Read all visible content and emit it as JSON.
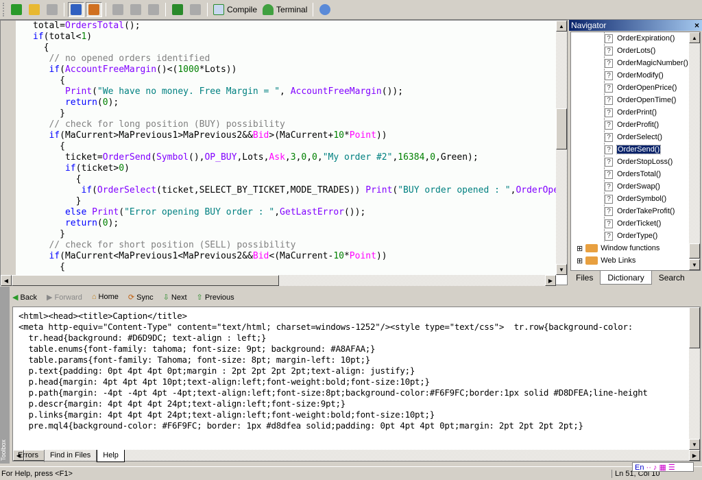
{
  "toolbar": {
    "items": [
      {
        "name": "new-file",
        "icon": "new-document-icon",
        "color": "#2a9a2a"
      },
      {
        "name": "open",
        "icon": "folder-open-icon",
        "color": "#e8b830"
      },
      {
        "name": "save",
        "icon": "save-disk-icon",
        "color": "#aaaaaa"
      },
      {
        "name": "navigator",
        "icon": "navigator-panel-icon",
        "color": "#3060c0",
        "pressed": true
      },
      {
        "name": "toolbox",
        "icon": "toolbox-book-icon",
        "color": "#d07020",
        "pressed": true
      },
      {
        "name": "cut",
        "icon": "scissors-icon",
        "color": "#aaaaaa"
      },
      {
        "name": "copy",
        "icon": "copy-icon",
        "color": "#aaaaaa"
      },
      {
        "name": "paste",
        "icon": "paste-icon",
        "color": "#aaaaaa"
      },
      {
        "name": "undo",
        "icon": "undo-arrow-icon",
        "color": "#2a8a2a"
      },
      {
        "name": "redo",
        "icon": "redo-arrow-icon",
        "color": "#aaaaaa"
      }
    ],
    "compile_label": "Compile",
    "terminal_label": "Terminal"
  },
  "editor": {
    "lines": [
      [
        [
          "t",
          "total="
        ],
        [
          "f",
          "OrdersTotal"
        ],
        [
          "t",
          "();"
        ]
      ],
      [
        [
          "k",
          "if"
        ],
        [
          "t",
          "(total<"
        ],
        [
          "n",
          "1"
        ],
        [
          "t",
          ")"
        ]
      ],
      [
        [
          "t",
          "  {"
        ]
      ],
      [
        [
          "c",
          "   // no opened orders identified"
        ]
      ],
      [
        [
          "k",
          "   if"
        ],
        [
          "t",
          "("
        ],
        [
          "f",
          "AccountFreeMargin"
        ],
        [
          "t",
          "()<("
        ],
        [
          "n",
          "1000"
        ],
        [
          "t",
          "*Lots))"
        ]
      ],
      [
        [
          "t",
          "     {"
        ]
      ],
      [
        [
          "f",
          "      Print"
        ],
        [
          "t",
          "("
        ],
        [
          "s",
          "\"We have no money. Free Margin = \""
        ],
        [
          "t",
          ", "
        ],
        [
          "f",
          "AccountFreeMargin"
        ],
        [
          "t",
          "());"
        ]
      ],
      [
        [
          "k",
          "      return"
        ],
        [
          "t",
          "("
        ],
        [
          "n",
          "0"
        ],
        [
          "t",
          ");"
        ]
      ],
      [
        [
          "t",
          "     }"
        ]
      ],
      [
        [
          "c",
          "   // check for long position (BUY) possibility"
        ]
      ],
      [
        [
          "k",
          "   if"
        ],
        [
          "t",
          "(MaCurrent>MaPrevious1>MaPrevious2&&"
        ],
        [
          "p",
          "Bid"
        ],
        [
          "t",
          ">(MaCurrent+"
        ],
        [
          "n",
          "10"
        ],
        [
          "t",
          "*"
        ],
        [
          "p",
          "Point"
        ],
        [
          "t",
          "))"
        ]
      ],
      [
        [
          "t",
          "     {"
        ]
      ],
      [
        [
          "t",
          "      ticket="
        ],
        [
          "f",
          "OrderSend"
        ],
        [
          "t",
          "("
        ],
        [
          "f",
          "Symbol"
        ],
        [
          "t",
          "(),"
        ],
        [
          "f",
          "OP_BUY"
        ],
        [
          "t",
          ",Lots,"
        ],
        [
          "p",
          "Ask"
        ],
        [
          "t",
          ","
        ],
        [
          "n",
          "3"
        ],
        [
          "t",
          ","
        ],
        [
          "n",
          "0"
        ],
        [
          "t",
          ","
        ],
        [
          "n",
          "0"
        ],
        [
          "t",
          ","
        ],
        [
          "s",
          "\"My order #2\""
        ],
        [
          "t",
          ","
        ],
        [
          "n",
          "16384"
        ],
        [
          "t",
          ","
        ],
        [
          "n",
          "0"
        ],
        [
          "t",
          ",Green);"
        ]
      ],
      [
        [
          "k",
          "      if"
        ],
        [
          "t",
          "(ticket>"
        ],
        [
          "n",
          "0"
        ],
        [
          "t",
          ")"
        ]
      ],
      [
        [
          "t",
          "        {"
        ]
      ],
      [
        [
          "k",
          "         if"
        ],
        [
          "t",
          "("
        ],
        [
          "f",
          "OrderSelect"
        ],
        [
          "t",
          "(ticket,SELECT_BY_TICKET,MODE_TRADES)) "
        ],
        [
          "f",
          "Print"
        ],
        [
          "t",
          "("
        ],
        [
          "s",
          "\"BUY order opened : \""
        ],
        [
          "t",
          ","
        ],
        [
          "f",
          "OrderOpenPrice"
        ],
        [
          "t",
          "());"
        ]
      ],
      [
        [
          "t",
          "        }"
        ]
      ],
      [
        [
          "k",
          "      else "
        ],
        [
          "f",
          "Print"
        ],
        [
          "t",
          "("
        ],
        [
          "s",
          "\"Error opening BUY order : \""
        ],
        [
          "t",
          ","
        ],
        [
          "f",
          "GetLastError"
        ],
        [
          "t",
          "());"
        ]
      ],
      [
        [
          "k",
          "      return"
        ],
        [
          "t",
          "("
        ],
        [
          "n",
          "0"
        ],
        [
          "t",
          ");"
        ]
      ],
      [
        [
          "t",
          "     }"
        ]
      ],
      [
        [
          "c",
          "   // check for short position (SELL) possibility"
        ]
      ],
      [
        [
          "k",
          "   if"
        ],
        [
          "t",
          "(MaCurrent<MaPrevious1<MaPrevious2&&"
        ],
        [
          "p",
          "Bid"
        ],
        [
          "t",
          "<(MaCurrent-"
        ],
        [
          "n",
          "10"
        ],
        [
          "t",
          "*"
        ],
        [
          "p",
          "Point"
        ],
        [
          "t",
          "))"
        ]
      ],
      [
        [
          "t",
          "     {"
        ]
      ]
    ]
  },
  "navigator": {
    "title": "Navigator",
    "items": [
      "OrderExpiration()",
      "OrderLots()",
      "OrderMagicNumber()",
      "OrderModify()",
      "OrderOpenPrice()",
      "OrderOpenTime()",
      "OrderPrint()",
      "OrderProfit()",
      "OrderSelect()",
      "OrderSend()",
      "OrderStopLoss()",
      "OrdersTotal()",
      "OrderSwap()",
      "OrderSymbol()",
      "OrderTakeProfit()",
      "OrderTicket()",
      "OrderType()"
    ],
    "selected": "OrderSend()",
    "folders": [
      "Window functions",
      "Web Links"
    ],
    "tabs": [
      "Files",
      "Dictionary",
      "Search"
    ],
    "active_tab": "Dictionary"
  },
  "help": {
    "toolbar": {
      "back": "Back",
      "forward": "Forward",
      "home": "Home",
      "sync": "Sync",
      "next": "Next",
      "previous": "Previous"
    },
    "lines": [
      "<html><head><title>Caption</title>",
      "<meta http-equiv=\"Content-Type\" content=\"text/html; charset=windows-1252\"/><style type=\"text/css\">  tr.row{background-color:",
      "  tr.head{background: #D6D9DC; text-align : left;}",
      "  table.enums{font-family: tahoma; font-size: 9pt; background: #A8AFAA;}",
      "  table.params{font-family: Tahoma; font-size: 8pt; margin-left: 10pt;}",
      "  p.text{padding: 0pt 4pt 4pt 0pt;margin : 2pt 2pt 2pt 2pt;text-align: justify;}",
      "  p.head{margin: 4pt 4pt 4pt 10pt;text-align:left;font-weight:bold;font-size:10pt;}",
      "  p.path{margin: -4pt -4pt 4pt -4pt;text-align:left;font-size:8pt;background-color:#F6F9FC;border:1px solid #D8DFEA;line-height",
      "  p.descr{margin: 4pt 4pt 4pt 24pt;text-align:left;font-size:9pt;}",
      "  p.links{margin: 4pt 4pt 4pt 24pt;text-align:left;font-weight:bold;font-size:10pt;}",
      "  pre.mql4{background-color: #F6F9FC; border: 1px #d8dfea solid;padding: 0pt 4pt 4pt 0pt;margin: 2pt 2pt 2pt 2pt;}"
    ],
    "tabs": [
      "Errors",
      "Find in Files",
      "Help"
    ],
    "active_tab": "Help",
    "toolbox_label": "Toolbox"
  },
  "status": {
    "help_text": "For Help, press <F1>",
    "position": "Ln 51, Col 10",
    "language": "En"
  }
}
